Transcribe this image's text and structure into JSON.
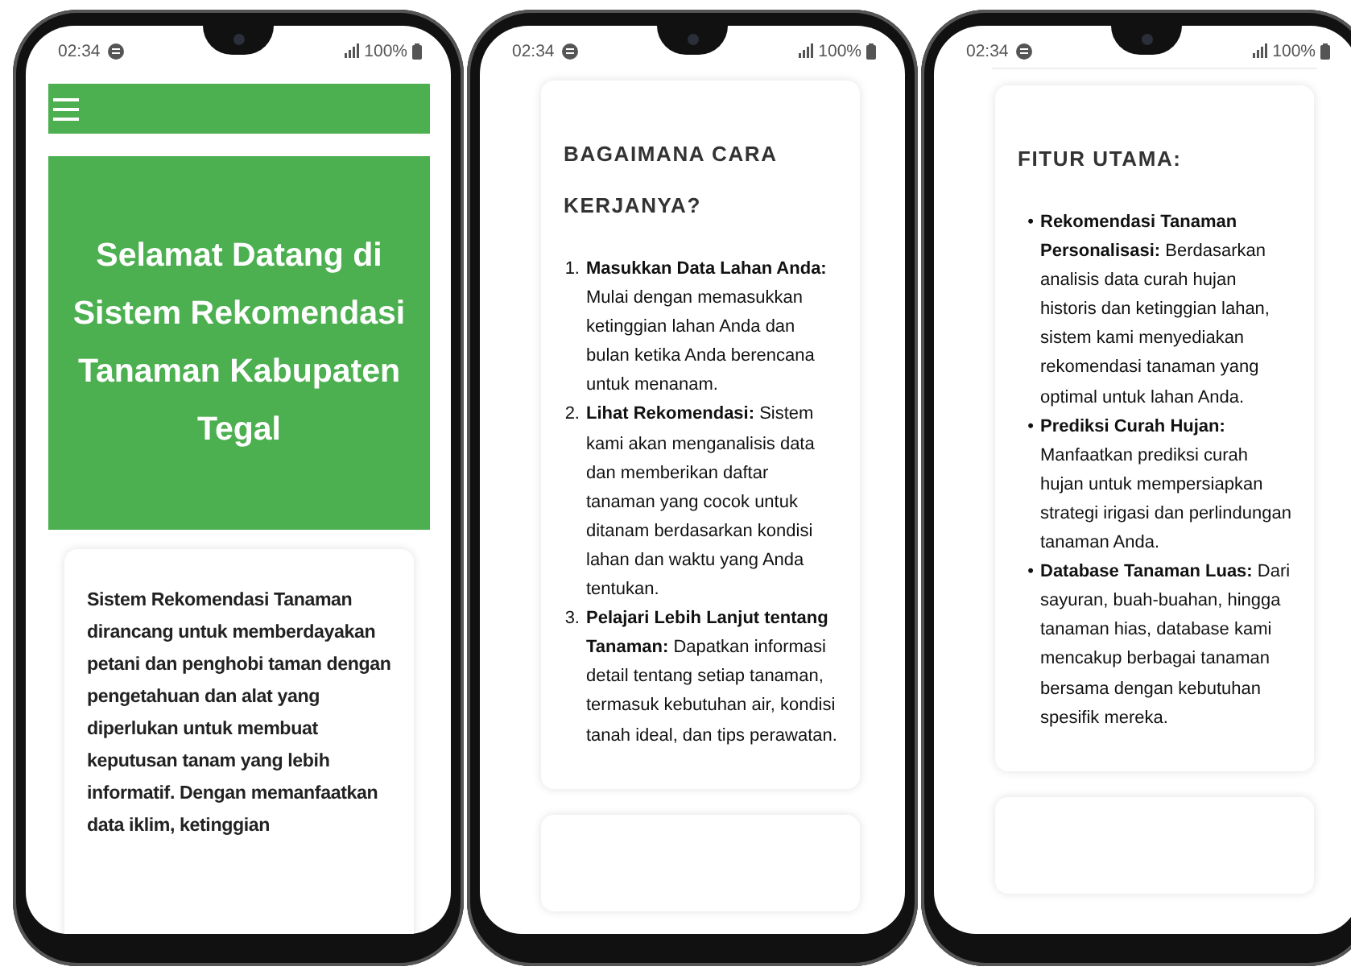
{
  "phones": [
    {
      "status": {
        "time": "02:34",
        "battery": "100%"
      },
      "kind": "home",
      "hero_title": "Selamat Datang di Sistem Rekomendasi Tanaman Kabupaten Tegal",
      "intro": "Sistem Rekomendasi Tanaman dirancang untuk memberdayakan petani dan penghobi taman dengan pengetahuan dan alat yang diperlukan untuk membuat keputusan tanam yang lebih informatif. Dengan memanfaatkan data iklim, ketinggian"
    },
    {
      "status": {
        "time": "02:34",
        "battery": "100%"
      },
      "kind": "list",
      "heading": "BAGAIMANA CARA KERJANYA?",
      "items": [
        {
          "marker": "1.",
          "text": "**Masukkan Data Lahan Anda:** Mulai dengan memasukkan ketinggian lahan Anda dan bulan ketika Anda berencana untuk menanam."
        },
        {
          "marker": "2.",
          "text": "**Lihat Rekomendasi:** Sistem kami akan menganalisis data dan memberikan daftar tanaman yang cocok untuk ditanam berdasarkan kondisi lahan dan waktu yang Anda tentukan."
        },
        {
          "marker": "3.",
          "text": "**Pelajari Lebih Lanjut tentang Tanaman:** Dapatkan informasi detail tentang setiap tanaman, termasuk kebutuhan air, kondisi tanah ideal, dan tips perawatan."
        }
      ]
    },
    {
      "status": {
        "time": "02:34",
        "battery": "100%"
      },
      "kind": "list",
      "heading": "FITUR UTAMA:",
      "items": [
        {
          "marker": "•",
          "text": "**Rekomendasi Tanaman Personalisasi:** Berdasarkan analisis data curah hujan historis dan ketinggian lahan, sistem kami menyediakan rekomendasi tanaman yang optimal untuk lahan Anda."
        },
        {
          "marker": "•",
          "text": "**Prediksi Curah Hujan:** Manfaatkan prediksi curah hujan untuk mempersiapkan strategi irigasi dan perlindungan tanaman Anda."
        },
        {
          "marker": "•",
          "text": "**Database Tanaman Luas:** Dari sayuran, buah-buahan, hingga tanaman hias, database kami mencakup berbagai tanaman bersama dengan kebutuhan spesifik mereka."
        }
      ]
    }
  ]
}
